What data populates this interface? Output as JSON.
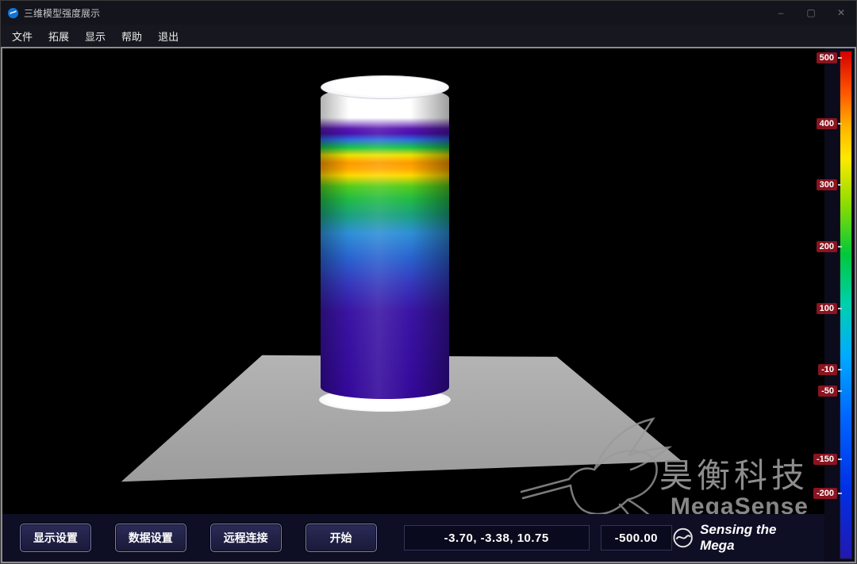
{
  "window": {
    "title": "三维模型强度展示"
  },
  "titlebar": {
    "minimize": "–",
    "maximize": "▢",
    "close": "✕"
  },
  "menu": {
    "items": [
      {
        "label": "文件"
      },
      {
        "label": "拓展"
      },
      {
        "label": "显示"
      },
      {
        "label": "帮助"
      },
      {
        "label": "退出"
      }
    ]
  },
  "controls": {
    "buttons": [
      {
        "label": "显示设置"
      },
      {
        "label": "数据设置"
      },
      {
        "label": "远程连接"
      },
      {
        "label": "开始"
      }
    ]
  },
  "status": {
    "coordinates": "-3.70, -3.38, 10.75",
    "scale_value": "-500.00"
  },
  "branding": {
    "watermark_cn": "昊衡科技",
    "watermark_en": "MegaSense",
    "tagline": "Sensing the Mega"
  },
  "colorbar": {
    "labels": [
      {
        "text": "500"
      },
      {
        "text": "400"
      },
      {
        "text": "300"
      },
      {
        "text": "200"
      },
      {
        "text": "100"
      },
      {
        "text": "-10"
      },
      {
        "text": "-50"
      },
      {
        "text": "-150"
      },
      {
        "text": "-200"
      }
    ],
    "label_color": "#8a1420",
    "gradient_stops": [
      [
        "#d40000",
        0
      ],
      [
        "#ff5500",
        8
      ],
      [
        "#ffb400",
        15
      ],
      [
        "#ffe800",
        21
      ],
      [
        "#8fdc00",
        30
      ],
      [
        "#00c83c",
        40
      ],
      [
        "#00cfae",
        50
      ],
      [
        "#00aaff",
        60
      ],
      [
        "#0066ff",
        72
      ],
      [
        "#0030e6",
        86
      ],
      [
        "#2218b0",
        100
      ]
    ]
  },
  "scene": {
    "platform_color": "#a8a8a8",
    "cylinder_stops": [
      [
        "#ffffff",
        0
      ],
      [
        "#ffffff",
        10
      ],
      [
        "#5a18b0",
        13.5
      ],
      [
        "#4a0fae",
        15
      ],
      [
        "#2d6ae0",
        17
      ],
      [
        "#18c24a",
        19.5
      ],
      [
        "#f0e000",
        22
      ],
      [
        "#ff9800",
        24.5
      ],
      [
        "#ffab00",
        26.5
      ],
      [
        "#ffd900",
        28.5
      ],
      [
        "#52cc1e",
        32
      ],
      [
        "#22bb44",
        36
      ],
      [
        "#1aa27c",
        41
      ],
      [
        "#2e8fd8",
        47
      ],
      [
        "#2a62cf",
        55
      ],
      [
        "#3538bd",
        63
      ],
      [
        "#3a14a4",
        72
      ],
      [
        "#34089a",
        100
      ]
    ]
  }
}
